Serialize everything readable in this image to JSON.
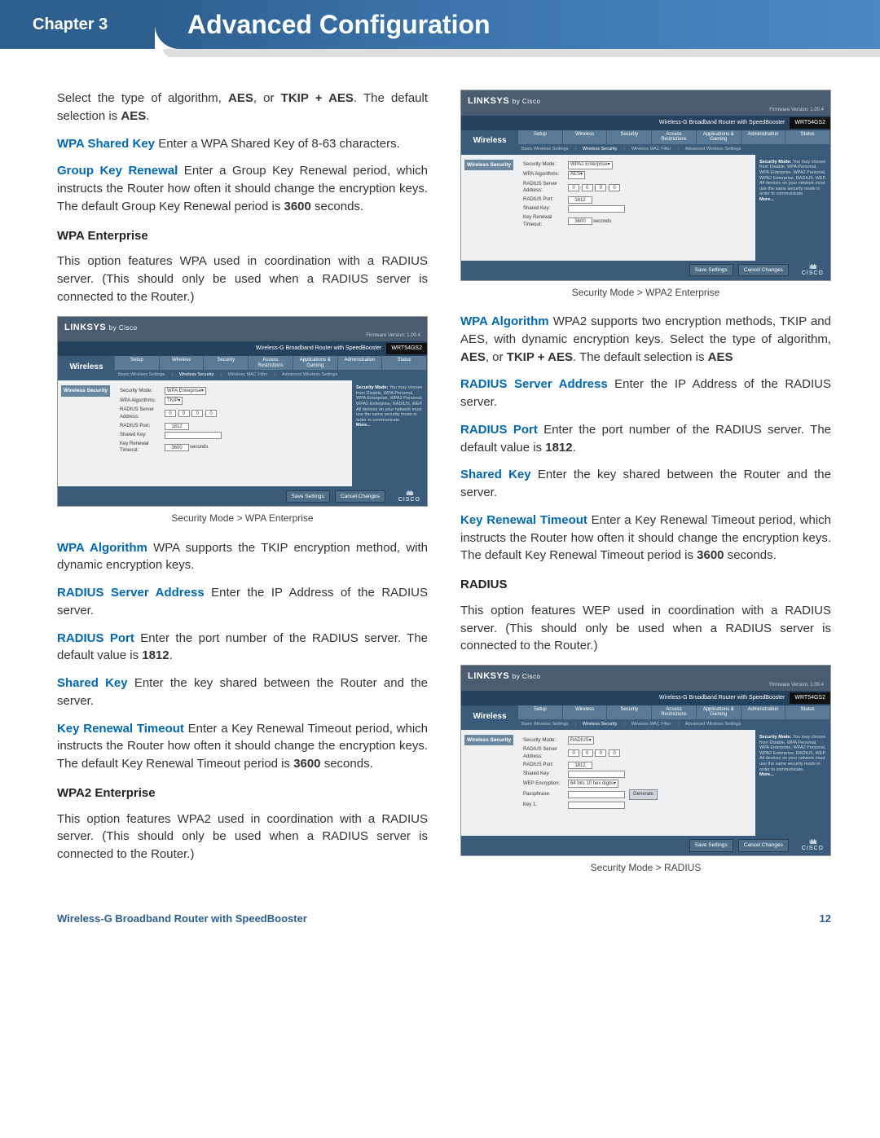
{
  "header": {
    "chapter": "Chapter 3",
    "title": "Advanced Configuration"
  },
  "left_col": {
    "p1_a": "Select the type of algorithm, ",
    "p1_b": "AES",
    "p1_c": ", or ",
    "p1_d": "TKIP + AES",
    "p1_e": ". The default selection is ",
    "p1_f": "AES",
    "p1_g": ".",
    "p2_h": "WPA Shared Key",
    "p2_t": " Enter a WPA Shared Key of 8-63 characters.",
    "p3_h": "Group Key Renewal",
    "p3_t1": " Enter a Group Key Renewal period, which instructs the Router how often it should change the encryption keys. The default Group Key Renewal period is ",
    "p3_b": "3600",
    "p3_t2": " seconds.",
    "sh1": "WPA Enterprise",
    "p4": "This option features WPA used in coordination with a RADIUS server. (This should only be used when a RADIUS server is connected to the Router.)",
    "cap1": "Security Mode > WPA Enterprise",
    "p5_h": "WPA Algorithm",
    "p5_t": " WPA supports the TKIP encryption method, with dynamic encryption keys.",
    "p6_h": "RADIUS Server Address",
    "p6_t": " Enter the IP Address of the RADIUS server.",
    "p7_h": "RADIUS Port",
    "p7_t1": " Enter the port number of the RADIUS server. The default value is ",
    "p7_b": "1812",
    "p7_t2": ".",
    "p8_h": "Shared Key",
    "p8_t": " Enter the key shared between the Router and the server.",
    "p9_h": "Key Renewal Timeout",
    "p9_t1": " Enter a Key Renewal Timeout period, which instructs the Router how often it should change the encryption keys. The default Key Renewal Timeout period is ",
    "p9_b": "3600",
    "p9_t2": " seconds.",
    "sh2": "WPA2 Enterprise",
    "p10": "This option features WPA2 used in coordination with a RADIUS server. (This should only be used when a RADIUS server is connected to the Router.)"
  },
  "right_col": {
    "cap1": "Security Mode > WPA2 Enterprise",
    "p1_h": "WPA Algorithm",
    "p1_t1": " WPA2 supports two encryption methods, TKIP and AES, with dynamic encryption keys. Select the type of algorithm, ",
    "p1_b1": "AES",
    "p1_t2": ", or ",
    "p1_b2": "TKIP + AES",
    "p1_t3": ". The default selection is ",
    "p1_b3": "AES",
    "p2_h": "RADIUS Server Address",
    "p2_t": " Enter the IP Address of the RADIUS server.",
    "p3_h": "RADIUS Port",
    "p3_t1": " Enter the port number of the RADIUS server. The default value is ",
    "p3_b": "1812",
    "p3_t2": ".",
    "p4_h": "Shared Key",
    "p4_t": " Enter the key shared between the Router and the server.",
    "p5_h": "Key Renewal Timeout",
    "p5_t1": " Enter a Key Renewal Timeout period, which instructs the Router how often it should change the encryption keys. The default Key Renewal Timeout period is ",
    "p5_b": "3600",
    "p5_t2": " seconds.",
    "sh1": "RADIUS",
    "p6": "This option features WEP used in coordination with a RADIUS server. (This should only be used when a RADIUS server is connected to the Router.)",
    "cap2": "Security Mode > RADIUS"
  },
  "ss": {
    "logo1": "LINKSYS",
    "logo2": "by Cisco",
    "fw": "Firmware Version: 1.00.4",
    "product": "Wireless-G Broadband Router with SpeedBooster",
    "model": "WRT54GS2",
    "side": "Wireless",
    "tabs": [
      "Setup",
      "Wireless",
      "Security",
      "Access Restrictions",
      "Applications & Gaming",
      "Administration",
      "Status"
    ],
    "subtabs": [
      "Basic Wireless Settings",
      "Wireless Security",
      "Wireless MAC Filter",
      "Advanced Wireless Settings"
    ],
    "left_lbl": "Wireless Security",
    "f_secmode": "Security Mode:",
    "f_wpaalg": "WPA Algorithms:",
    "f_radaddr": "RADIUS Server Address:",
    "f_radport": "RADIUS Port:",
    "f_shared": "Shared Key:",
    "f_renew": "Key Renewal Timeout:",
    "f_wepenc": "WEP Encryption:",
    "f_pass": "Passphrase:",
    "f_key1": "Key 1:",
    "v_wpaent": "WPA Enterprise",
    "v_wpa2ent": "WPA2 Enterprise",
    "v_radius": "RADIUS",
    "v_tkip": "TKIP",
    "v_aes": "AES",
    "v_0": "0",
    "v_1812": "1812",
    "v_3600": "3600",
    "v_seconds": "seconds",
    "v_wep": "64 bits 10 hex digits",
    "btn_gen": "Generate",
    "btn_save": "Save Settings",
    "btn_cancel": "Cancel Changes",
    "cisco": "CISCO",
    "help_h": "Security Mode:",
    "help_t": "You may choose from Disable, WPA Personal, WPA Enterprise, WPA2 Personal, WPA2 Enterprise, RADIUS, WEP. All devices on your network must use the same security mode in order to communicate.",
    "more": "More..."
  },
  "footer": {
    "product": "Wireless-G Broadband Router with SpeedBooster",
    "page": "12"
  }
}
